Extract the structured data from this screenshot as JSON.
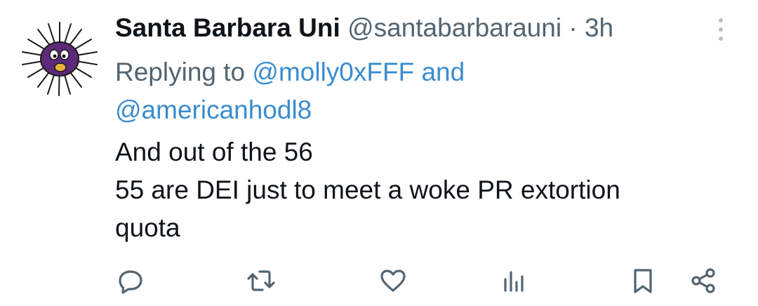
{
  "author": {
    "display_name": "Santa Barbara Uni",
    "handle": "@santabarbarauni",
    "separator": "·",
    "time": "3h",
    "avatar_icon": "sea-urchin-avatar"
  },
  "reply_context": {
    "prefix": "Replying to",
    "mention_1": "@molly0xFFF",
    "conjunction": "and",
    "mention_2": "@americanhodl8"
  },
  "tweet": {
    "lines": [
      "And out of the 56",
      "55 are DEI just to meet a woke PR extortion",
      "quota"
    ]
  },
  "actions": [
    {
      "name": "reply",
      "icon": "reply-icon"
    },
    {
      "name": "retweet",
      "icon": "retweet-icon"
    },
    {
      "name": "like",
      "icon": "heart-icon"
    },
    {
      "name": "views",
      "icon": "analytics-icon"
    },
    {
      "name": "bookmark",
      "icon": "bookmark-icon"
    },
    {
      "name": "share",
      "icon": "share-icon"
    }
  ],
  "colors": {
    "text": "#0f1419",
    "secondary": "#536471",
    "link": "#3a8ccf",
    "icon": "#536471"
  }
}
